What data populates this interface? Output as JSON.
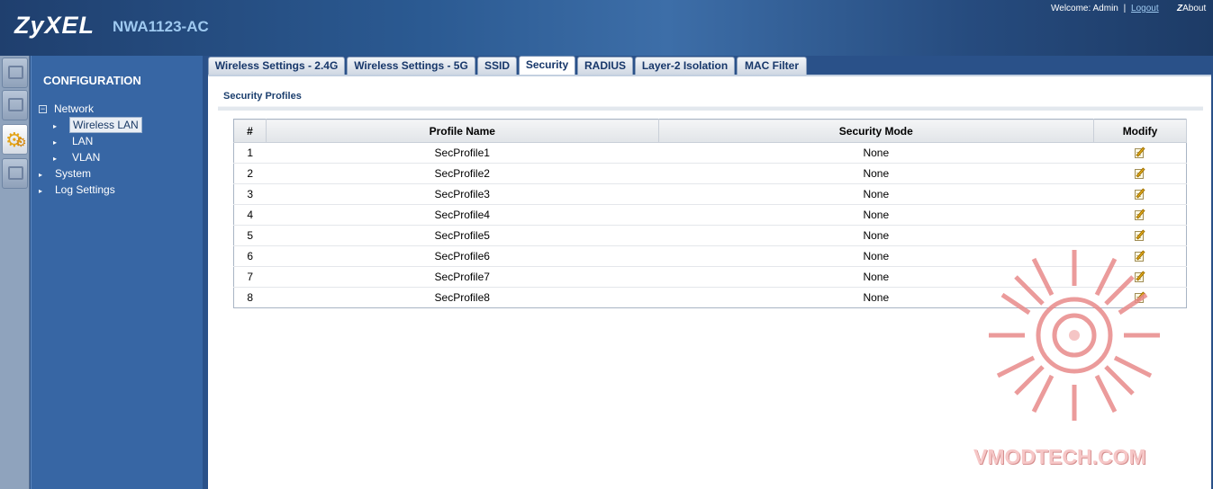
{
  "header": {
    "brand": "ZyXEL",
    "model": "NWA1123-AC",
    "welcome_label": "Welcome:",
    "user": "Admin",
    "separator": "|",
    "logout": "Logout",
    "about_z": "Z",
    "about": "About"
  },
  "sidebar": {
    "title": "CONFIGURATION",
    "items": [
      {
        "label": "Network",
        "toggle": "−"
      },
      {
        "label": "Wireless LAN"
      },
      {
        "label": "LAN"
      },
      {
        "label": "VLAN"
      },
      {
        "label": "System"
      },
      {
        "label": "Log Settings"
      }
    ]
  },
  "tabs": [
    "Wireless Settings - 2.4G",
    "Wireless Settings - 5G",
    "SSID",
    "Security",
    "RADIUS",
    "Layer-2 Isolation",
    "MAC Filter"
  ],
  "active_tab": "Security",
  "section": {
    "title": "Security Profiles"
  },
  "table": {
    "columns": [
      "#",
      "Profile Name",
      "Security Mode",
      "Modify"
    ],
    "rows": [
      {
        "num": "1",
        "name": "SecProfile1",
        "mode": "None"
      },
      {
        "num": "2",
        "name": "SecProfile2",
        "mode": "None"
      },
      {
        "num": "3",
        "name": "SecProfile3",
        "mode": "None"
      },
      {
        "num": "4",
        "name": "SecProfile4",
        "mode": "None"
      },
      {
        "num": "5",
        "name": "SecProfile5",
        "mode": "None"
      },
      {
        "num": "6",
        "name": "SecProfile6",
        "mode": "None"
      },
      {
        "num": "7",
        "name": "SecProfile7",
        "mode": "None"
      },
      {
        "num": "8",
        "name": "SecProfile8",
        "mode": "None"
      }
    ]
  },
  "watermark": "VMODTECH.COM",
  "colors": {
    "header_bg": "#2b5a92",
    "sidebar_bg": "#3766a4",
    "model_text": "#9ec9f0",
    "tab_text": "#17376a",
    "watermark": "#e88a8a"
  }
}
